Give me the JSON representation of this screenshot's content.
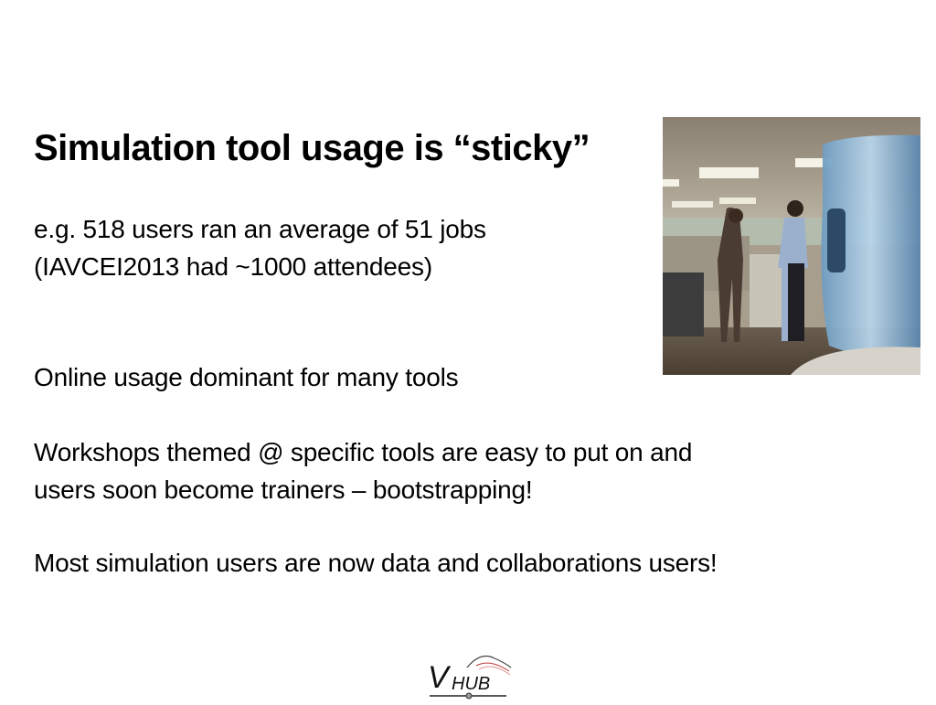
{
  "slide": {
    "title": "Simulation tool usage is “sticky”",
    "paragraphs": [
      {
        "lines": [
          "e.g. 518 users ran an average of 51 jobs",
          "(IAVCEI2013 had ~1000 attendees)"
        ]
      },
      {
        "lines": [
          "Online usage dominant for many tools"
        ]
      },
      {
        "lines": [
          "Workshops themed @ specific tools are easy to put on and",
          "users soon become trainers – bootstrapping!"
        ]
      },
      {
        "lines": [
          "Most simulation users are now data and collaborations users!"
        ]
      }
    ],
    "photo": {
      "description": "office-water-cooler-photo"
    },
    "logo": {
      "text_v": "V",
      "text_hub": "HUB"
    }
  }
}
